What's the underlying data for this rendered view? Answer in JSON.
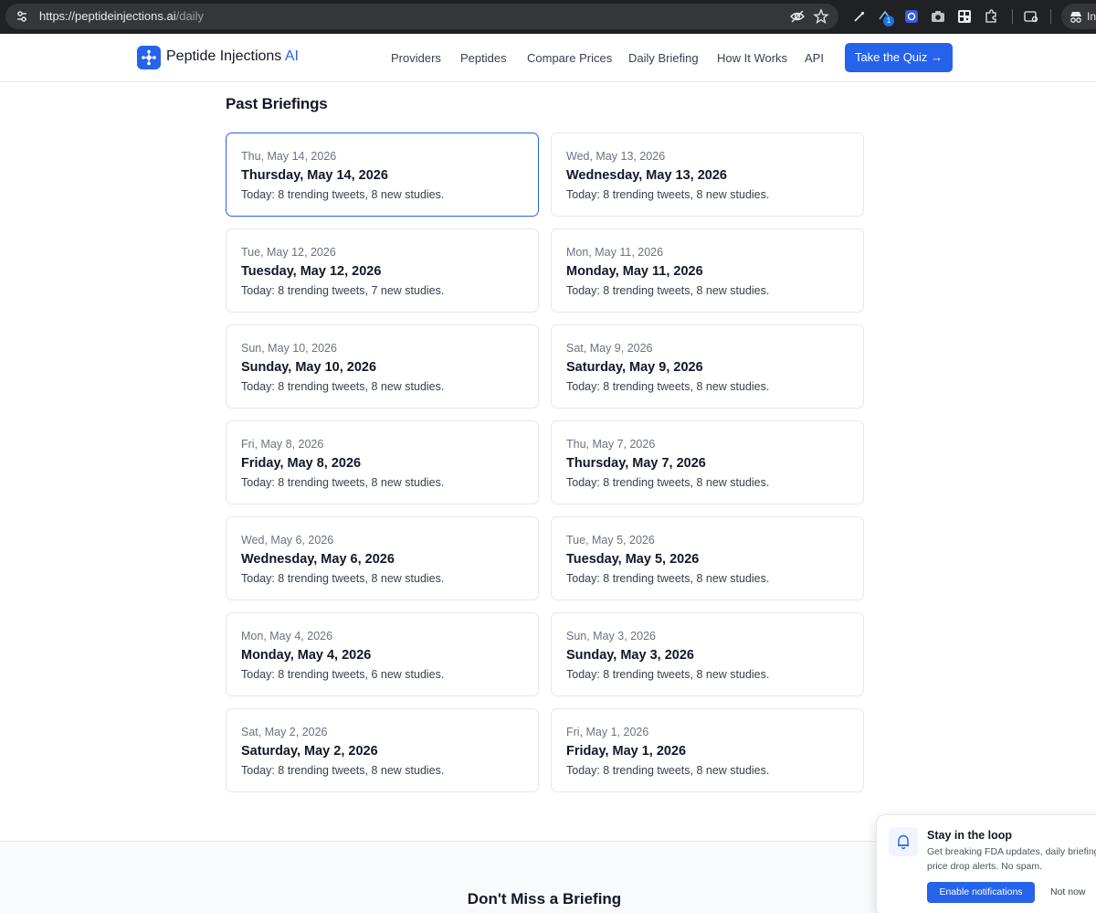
{
  "browser": {
    "url_host": "https://peptideinjections.ai",
    "url_path": "/daily",
    "extension_badge": "1",
    "profile_label": "In"
  },
  "header": {
    "logo_text": "Peptide Injections",
    "logo_accent": "AI",
    "nav": [
      "Providers",
      "Peptides",
      "Compare Prices",
      "Daily Briefing",
      "How It Works",
      "API"
    ],
    "cta_label": "Take the Quiz →"
  },
  "main": {
    "section_title": "Past Briefings",
    "briefings": [
      {
        "date_short": "Thu, May 14, 2026",
        "title": "Thursday, May 14, 2026",
        "summary": "Today: 8 trending tweets, 8 new studies."
      },
      {
        "date_short": "Wed, May 13, 2026",
        "title": "Wednesday, May 13, 2026",
        "summary": "Today: 8 trending tweets, 8 new studies."
      },
      {
        "date_short": "Tue, May 12, 2026",
        "title": "Tuesday, May 12, 2026",
        "summary": "Today: 8 trending tweets, 7 new studies."
      },
      {
        "date_short": "Mon, May 11, 2026",
        "title": "Monday, May 11, 2026",
        "summary": "Today: 8 trending tweets, 8 new studies."
      },
      {
        "date_short": "Sun, May 10, 2026",
        "title": "Sunday, May 10, 2026",
        "summary": "Today: 8 trending tweets, 8 new studies."
      },
      {
        "date_short": "Sat, May 9, 2026",
        "title": "Saturday, May 9, 2026",
        "summary": "Today: 8 trending tweets, 8 new studies."
      },
      {
        "date_short": "Fri, May 8, 2026",
        "title": "Friday, May 8, 2026",
        "summary": "Today: 8 trending tweets, 8 new studies."
      },
      {
        "date_short": "Thu, May 7, 2026",
        "title": "Thursday, May 7, 2026",
        "summary": "Today: 8 trending tweets, 8 new studies."
      },
      {
        "date_short": "Wed, May 6, 2026",
        "title": "Wednesday, May 6, 2026",
        "summary": "Today: 8 trending tweets, 8 new studies."
      },
      {
        "date_short": "Tue, May 5, 2026",
        "title": "Tuesday, May 5, 2026",
        "summary": "Today: 8 trending tweets, 8 new studies."
      },
      {
        "date_short": "Mon, May 4, 2026",
        "title": "Monday, May 4, 2026",
        "summary": "Today: 8 trending tweets, 6 new studies."
      },
      {
        "date_short": "Sun, May 3, 2026",
        "title": "Sunday, May 3, 2026",
        "summary": "Today: 8 trending tweets, 8 new studies."
      },
      {
        "date_short": "Sat, May 2, 2026",
        "title": "Saturday, May 2, 2026",
        "summary": "Today: 8 trending tweets, 8 new studies."
      },
      {
        "date_short": "Fri, May 1, 2026",
        "title": "Friday, May 1, 2026",
        "summary": "Today: 8 trending tweets, 8 new studies."
      }
    ]
  },
  "band": {
    "title": "Don't Miss a Briefing"
  },
  "notification": {
    "title": "Stay in the loop",
    "body": "Get breaking FDA updates, daily briefing price drop alerts. No spam.",
    "enable_label": "Enable notifications",
    "dismiss_label": "Not now"
  },
  "colors": {
    "brand": "#2563eb",
    "chrome_bg": "#202124"
  },
  "icons": [
    "tune-icon",
    "eye-off-icon",
    "star-icon",
    "extension-pin-icon",
    "extension-puzzle-icon",
    "side-panel-icon",
    "incognito-icon",
    "bell-icon",
    "logo-mark-icon"
  ]
}
